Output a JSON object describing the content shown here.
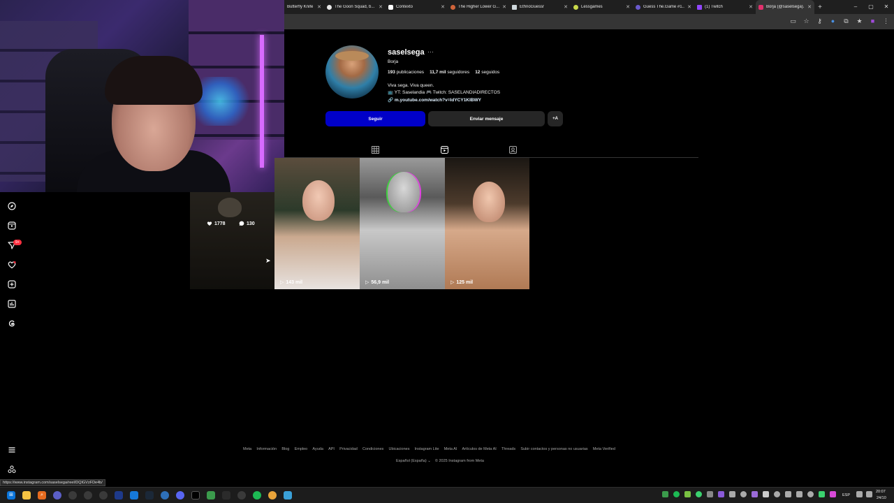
{
  "browser": {
    "tabs": [
      {
        "title": "Butterfly Knife D...",
        "favicon_color": "#d9a23a"
      },
      {
        "title": "The Goon Squad, b...",
        "favicon_color": "#e8e8e8"
      },
      {
        "title": "Contexto",
        "favicon_color": "#ffffff"
      },
      {
        "title": "The Higher Lower G...",
        "favicon_color": "#d0643a"
      },
      {
        "title": "EthnoGuessr",
        "favicon_color": "#cfd8dc"
      },
      {
        "title": "Lessgames",
        "favicon_color": "#c8d84a"
      },
      {
        "title": "Guess The.Game #1...",
        "favicon_color": "#6a5acd"
      },
      {
        "title": "(1) Twitch",
        "favicon_color": "#9146ff"
      },
      {
        "title": "Borja (@saselsega)...",
        "favicon_color": "#e1306c"
      }
    ],
    "new_tab_label": "+",
    "window_controls": [
      "–",
      "▢",
      "✕"
    ]
  },
  "profile": {
    "username": "saselsega",
    "more_label": "···",
    "full_name": "Borja",
    "stats": {
      "posts_count": "193",
      "posts_label": "publicaciones",
      "followers_count": "11,7 mil",
      "followers_label": "seguidores",
      "following_count": "12",
      "following_label": "seguidos"
    },
    "bio_line1": "Viva sega. Viva queen.",
    "bio_line2": "📺 YT: Saselandia 🎮 Twitch: SASELANDIADIRECTOS",
    "bio_link": "m.youtube.com/watch?v=IdYCY1KIBWY",
    "follow_button": "Seguir",
    "message_button": "Enviar mensaje",
    "add_user_button": "+A"
  },
  "reels": [
    {
      "likes": "1778",
      "comments": "130",
      "hovered": true
    },
    {
      "views": "143 mil"
    },
    {
      "views": "56,9 mil"
    },
    {
      "views": "125 mil"
    }
  ],
  "footer": {
    "links": [
      "Meta",
      "Información",
      "Blog",
      "Empleo",
      "Ayuda",
      "API",
      "Privacidad",
      "Condiciones",
      "Ubicaciones",
      "Instagram Lite",
      "Meta AI",
      "Artículos de Meta AI",
      "Threads",
      "Subir contactos y personas no usuarias",
      "Meta Verified"
    ],
    "language": "Español (España)",
    "copyright": "© 2025 Instagram from Meta"
  },
  "status_url": "https://www.instagram.com/saselsega/reel/DQIGVzFDe4b/",
  "taskbar": {
    "language": "ESP",
    "time": "20:07",
    "date": "24/10"
  },
  "colors": {
    "follow_blue": "#0000c8",
    "secondary_button": "#262626",
    "badge_red": "#ff3040"
  },
  "sidebar_icons": [
    "compass-icon",
    "reels-icon",
    "messages-icon",
    "heart-icon",
    "create-icon",
    "dashboard-icon",
    "threads-icon",
    "menu-icon",
    "meta-icon"
  ],
  "sidebar_badge": "9+"
}
